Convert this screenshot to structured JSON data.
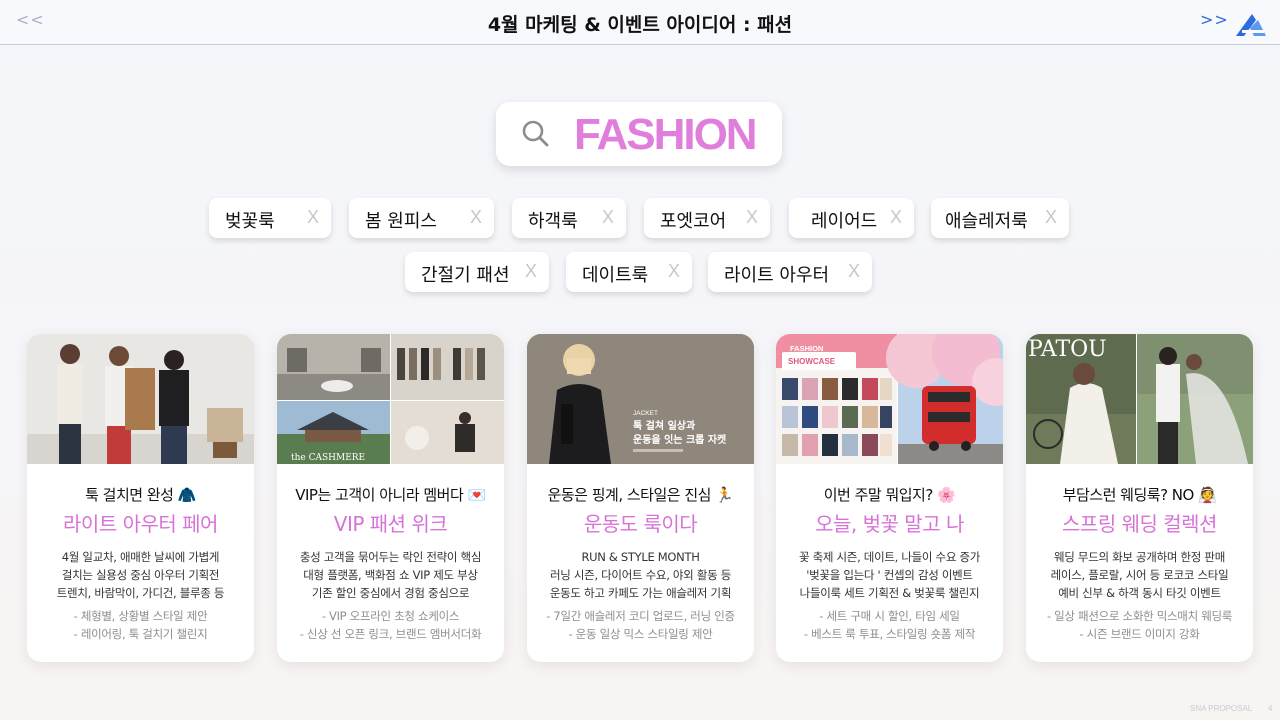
{
  "header": {
    "prev_label": "<<",
    "next_label": ">>",
    "title": "4월 마케팅 & 이벤트 아이디어 : 패션"
  },
  "search": {
    "query": "FASHION",
    "icon": "search-icon"
  },
  "chips": [
    {
      "label": "벚꽃룩",
      "close": "X"
    },
    {
      "label": "봄 원피스",
      "close": "X"
    },
    {
      "label": "하객룩",
      "close": "X"
    },
    {
      "label": "포엣코어",
      "close": "X"
    },
    {
      "label": "레이어드",
      "close": "X"
    },
    {
      "label": "애슬레저룩",
      "close": "X"
    },
    {
      "label": "간절기 패션",
      "close": "X"
    },
    {
      "label": "데이트룩",
      "close": "X"
    },
    {
      "label": "라이트 아우터",
      "close": "X"
    }
  ],
  "cards": [
    {
      "heading": "툭 걸치면 완성 🧥",
      "accent": "라이트 아우터 페어",
      "body": [
        "4월 일교차, 애매한 날씨에 가볍게",
        "걸치는 실용성 중심 아우터 기획전",
        "트렌치, 바람막이, 가디건, 블루종 등"
      ],
      "bullets": [
        "- 체형별, 상황별 스타일 제안",
        "- 레이어링, 툭 걸치기 챌린지"
      ]
    },
    {
      "heading": "VIP는 고객이 아니라 멤버다 💌",
      "accent": "VIP 패션 위크",
      "image_text": "the CASHMERE",
      "body": [
        "충성 고객을 묶어두는 락인 전략이 핵심",
        "대형 플랫폼, 백화점 쇼 VIP 제도 부상",
        "기존 할인 중심에서 경험 중심으로"
      ],
      "bullets": [
        "- VIP 오프라인 초청 쇼케이스",
        "- 신상 선 오픈 링크, 브랜드 엠버서더화"
      ]
    },
    {
      "heading": "운동은 핑계, 스타일은 진심 🏃",
      "accent": "운동도 룩이다",
      "image_text": [
        "JACKET",
        "툭 걸쳐 일상과",
        "운동을 잇는 크롭 자켓"
      ],
      "body": [
        "RUN & STYLE MONTH",
        "러닝 시즌, 다이어트 수요, 야외 활동 등",
        "운동도 하고 카페도 가는 애슬레저 기획"
      ],
      "bullets": [
        "- 7일간 애슬레저 코디 업로드, 러닝 인증",
        "- 운동 일상 믹스 스타일링 제안"
      ]
    },
    {
      "heading": "이번 주말 뭐입지? 🌸",
      "accent": "오늘, 벚꽃 말고 나",
      "image_text": [
        "FASHION",
        "SHOWCASE"
      ],
      "body": [
        "꽃 축제 시즌, 데이트, 나들이 수요 증가",
        "'벚꽃을 입는다 ' 컨셉의 감성 이벤트",
        "나들이룩 세트 기획전 & 벚꽃룩 챌린지"
      ],
      "bullets": [
        "- 세트 구매 시 할인, 타임 세일",
        "- 베스트 룩 투표, 스타일링 숏폼 제작"
      ]
    },
    {
      "heading": "부담스런 웨딩룩? NO 👰",
      "accent": "스프링 웨딩 컬렉션",
      "image_text": "PATOU",
      "body": [
        "웨딩 무드의 화보 공개하며 한정 판매",
        "레이스, 플로랄, 시어 등 로코코 스타일",
        "예비 신부 & 하객 동시 타깃 이벤트"
      ],
      "bullets": [
        "- 일상 패션으로 소화한 믹스매치 웨딩룩",
        "- 시즌 브랜드 이미지 강화"
      ]
    }
  ],
  "footer": {
    "label": "SNA PROPOSAL",
    "page": "4"
  },
  "colors": {
    "accent": "#d773d7",
    "search_text": "#e07fdb",
    "next_arrow": "#2f6bdc",
    "prev_arrow": "#a9b1c6"
  }
}
